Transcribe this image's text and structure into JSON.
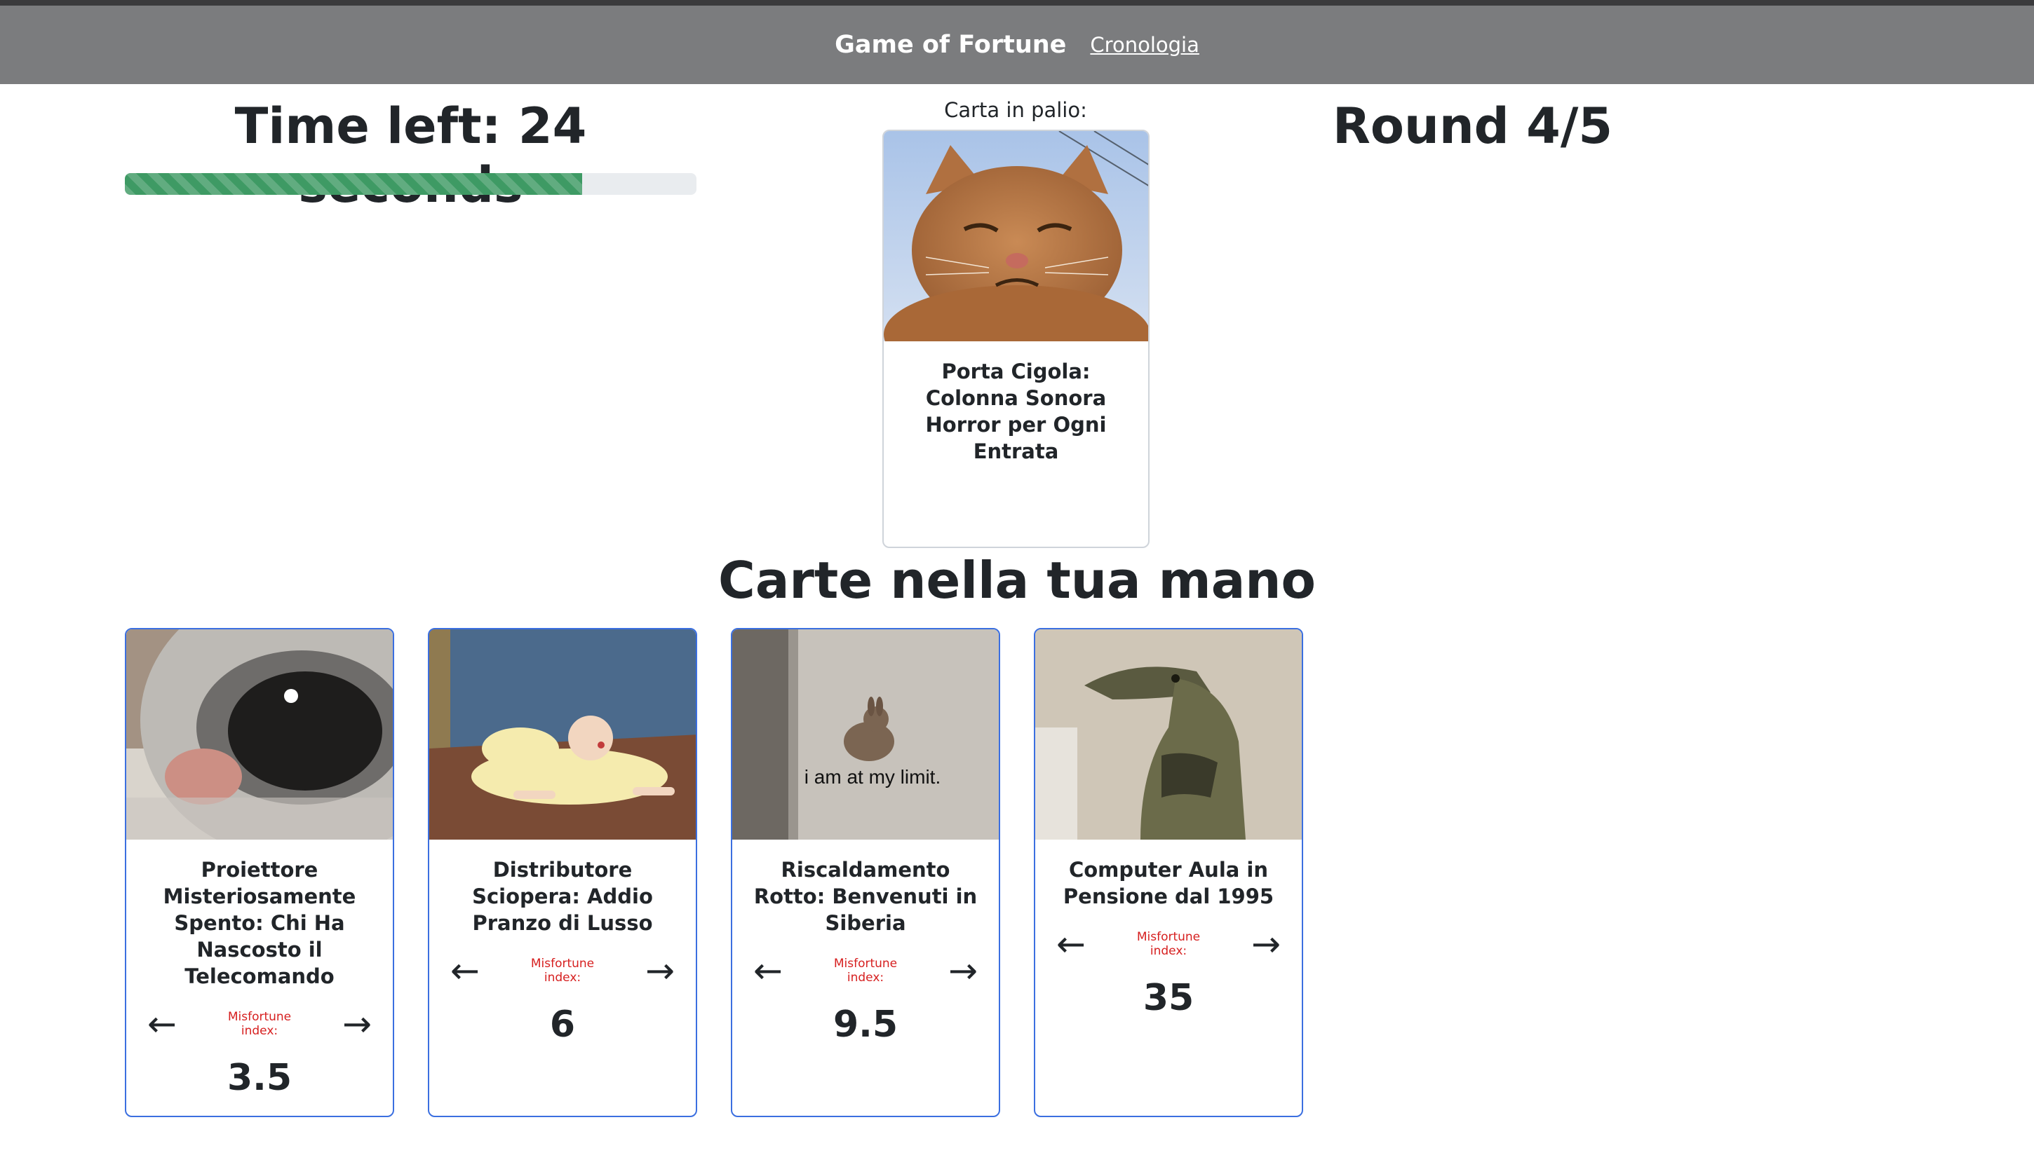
{
  "nav": {
    "brand": "Game of Fortune",
    "link": "Cronologia"
  },
  "timer": {
    "label": "Time left: 24 seconds",
    "progress_fraction": 0.8
  },
  "round": {
    "label": "Round 4/5"
  },
  "stake": {
    "label": "Carta in palio:",
    "card": {
      "title": "Porta Cigola: Colonna Sonora Horror per Ogni Entrata",
      "image": "orange-cat-grimace"
    }
  },
  "hand": {
    "title": "Carte nella tua mano",
    "misfortune_label": "Misfortune index:",
    "cards": [
      {
        "title": "Proiettore Misteriosamente Spento: Chi Ha Nascosto il Telecomando",
        "score": "3.5",
        "image": "closeup-animal-eye"
      },
      {
        "title": "Distributore Sciopera: Addio Pranzo di Lusso",
        "score": "6",
        "image": "cartoon-man-lying-floor"
      },
      {
        "title": "Riscaldamento Rotto: Benvenuti in Siberia",
        "score": "9.5",
        "image": "small-rabbit",
        "image_caption": "i am at my limit."
      },
      {
        "title": "Computer Aula in Pensione dal 1995",
        "score": "35",
        "image": "lizard-figure"
      }
    ]
  }
}
